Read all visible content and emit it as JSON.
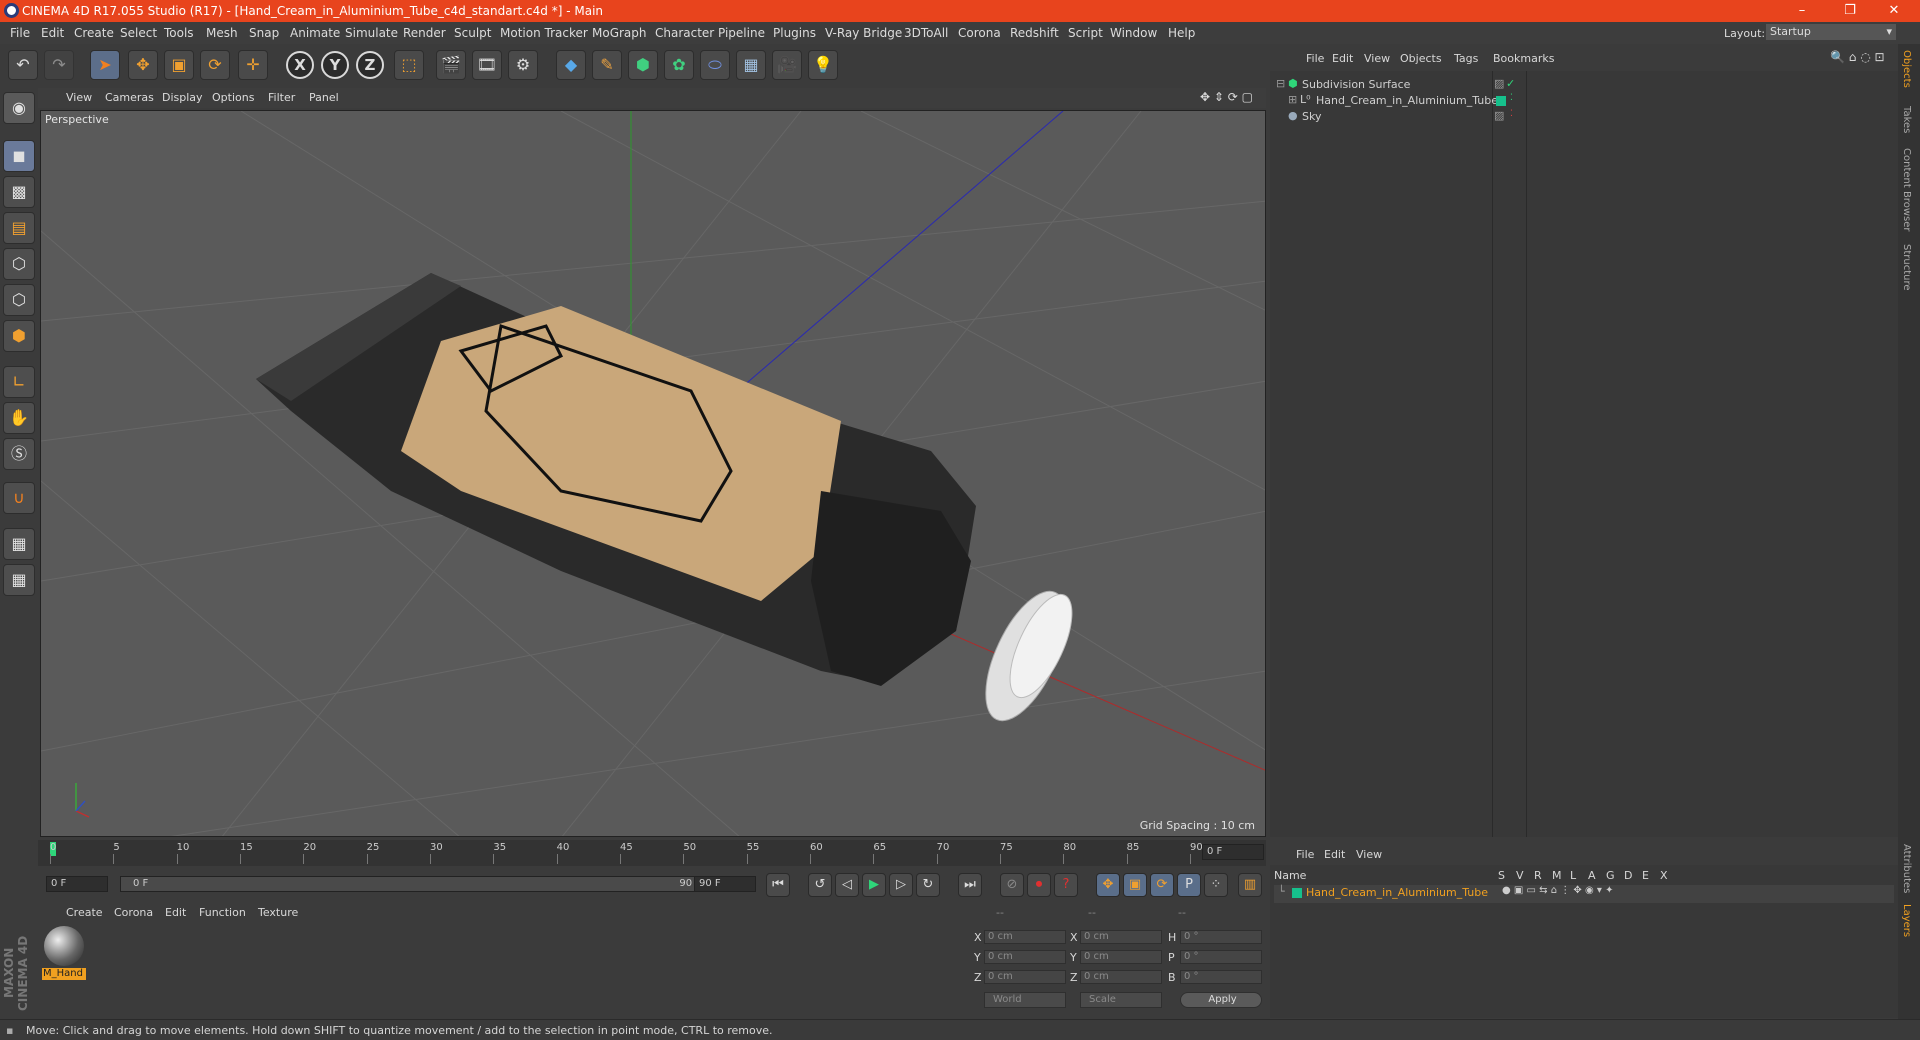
{
  "window": {
    "title": "CINEMA 4D R17.055 Studio (R17) - [Hand_Cream_in_Aluminium_Tube_c4d_standart.c4d *] - Main",
    "minimize": "–",
    "maximize": "❐",
    "close": "✕"
  },
  "menu": [
    "File",
    "Edit",
    "Create",
    "Select",
    "Tools",
    "Mesh",
    "Snap",
    "Animate",
    "Simulate",
    "Render",
    "Sculpt",
    "Motion Tracker",
    "MoGraph",
    "Character",
    "Pipeline",
    "Plugins",
    "V-Ray Bridge",
    "3DToAll",
    "Corona",
    "Redshift",
    "Script",
    "Window",
    "Help"
  ],
  "layout": {
    "label": "Layout:",
    "value": "Startup"
  },
  "toolbar": {
    "x_label": "X",
    "y_label": "Y",
    "z_label": "Z"
  },
  "viewport_menu": [
    "View",
    "Cameras",
    "Display",
    "Options",
    "Filter",
    "Panel"
  ],
  "viewport": {
    "label": "Perspective",
    "grid_spacing": "Grid Spacing : 10 cm"
  },
  "timeline": {
    "ticks": [
      "0",
      "5",
      "10",
      "15",
      "20",
      "25",
      "30",
      "35",
      "40",
      "45",
      "50",
      "55",
      "60",
      "65",
      "70",
      "75",
      "80",
      "85",
      "90"
    ],
    "current_frame": "0 F"
  },
  "transport": {
    "start": "0 F",
    "range_start": "0 F",
    "range_end": "90 F",
    "end": "90 F"
  },
  "material_panel": {
    "menu": [
      "Create",
      "Corona",
      "Edit",
      "Function",
      "Texture"
    ],
    "material_name": "M_Hand"
  },
  "coords": {
    "header": [
      "--",
      "--",
      "--"
    ],
    "rows": [
      {
        "a": "X",
        "av": "0 cm",
        "b": "X",
        "bv": "0 cm",
        "c": "H",
        "cv": "0 °"
      },
      {
        "a": "Y",
        "av": "0 cm",
        "b": "Y",
        "bv": "0 cm",
        "c": "P",
        "cv": "0 °"
      },
      {
        "a": "Z",
        "av": "0 cm",
        "b": "Z",
        "bv": "0 cm",
        "c": "B",
        "cv": "0 °"
      }
    ],
    "space": "World",
    "mode": "Scale",
    "apply": "Apply"
  },
  "object_manager": {
    "menu": [
      "File",
      "Edit",
      "View",
      "Objects",
      "Tags",
      "Bookmarks"
    ],
    "objects": [
      "Subdivision Surface",
      "Hand_Cream_in_Aluminium_Tube",
      "Sky"
    ]
  },
  "layer_manager": {
    "menu": [
      "File",
      "Edit",
      "View"
    ],
    "header_name": "Name",
    "columns": [
      "S",
      "V",
      "R",
      "M",
      "L",
      "A",
      "G",
      "D",
      "E",
      "X"
    ],
    "row": "Hand_Cream_in_Aluminium_Tube"
  },
  "right_tabs": [
    "Objects",
    "Takes",
    "Content Browser",
    "Structure"
  ],
  "right_tabs_bottom": [
    "Attributes",
    "Layers"
  ],
  "brand": "MAXON CINEMA 4D",
  "status": "Move: Click and drag to move elements. Hold down SHIFT to quantize movement / add to the selection in point mode, CTRL to remove.",
  "colors": {
    "title_bar": "#e8441d",
    "accent_green": "#16c08c",
    "orange_text": "#f0a020"
  }
}
